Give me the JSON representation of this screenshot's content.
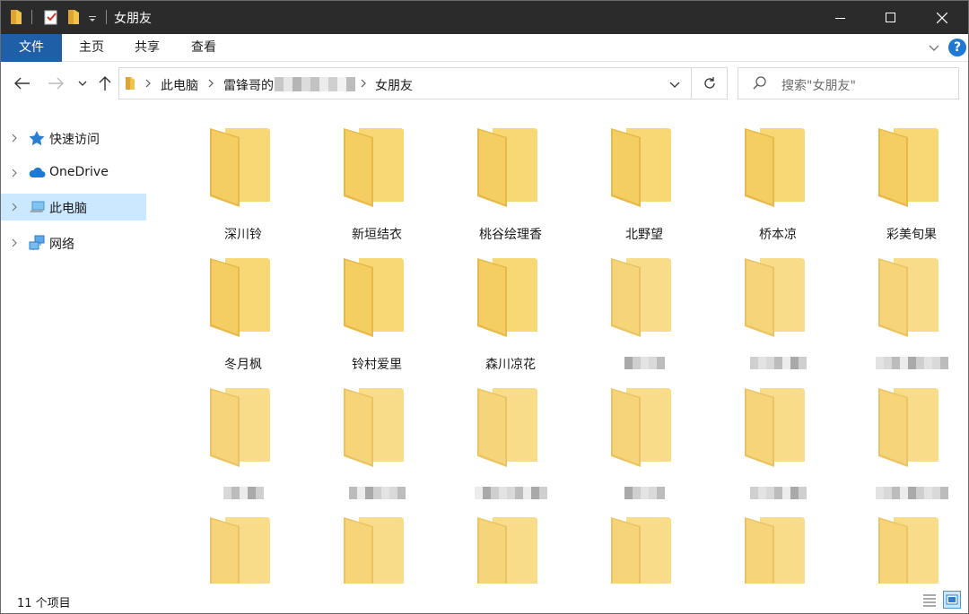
{
  "window": {
    "title": "女朋友"
  },
  "ribbon": {
    "tabs": [
      "文件",
      "主页",
      "共享",
      "查看"
    ]
  },
  "address": {
    "crumbs": [
      "此电脑",
      "雷锋哥的",
      "女朋友"
    ]
  },
  "search": {
    "placeholder": "搜索\"女朋友\""
  },
  "nav": {
    "items": [
      {
        "label": "快速访问",
        "icon": "star-icon"
      },
      {
        "label": "OneDrive",
        "icon": "cloud-icon"
      },
      {
        "label": "此电脑",
        "icon": "computer-icon"
      },
      {
        "label": "网络",
        "icon": "network-icon"
      }
    ],
    "selected": "此电脑"
  },
  "folders": [
    {
      "name": "深川铃"
    },
    {
      "name": "新垣结衣"
    },
    {
      "name": "桃谷绘理香"
    },
    {
      "name": "北野望"
    },
    {
      "name": "桥本凉"
    },
    {
      "name": "彩美旬果"
    },
    {
      "name": "冬月枫"
    },
    {
      "name": "铃村爱里"
    },
    {
      "name": "森川凉花"
    }
  ],
  "status": {
    "item_count": "11 个项目"
  },
  "colors": {
    "titlebar": "#2b2b2b",
    "file_tab": "#1e5fa8",
    "selection": "#cce8ff",
    "folder_front": "#f8d775",
    "folder_back": "#e8b948"
  }
}
